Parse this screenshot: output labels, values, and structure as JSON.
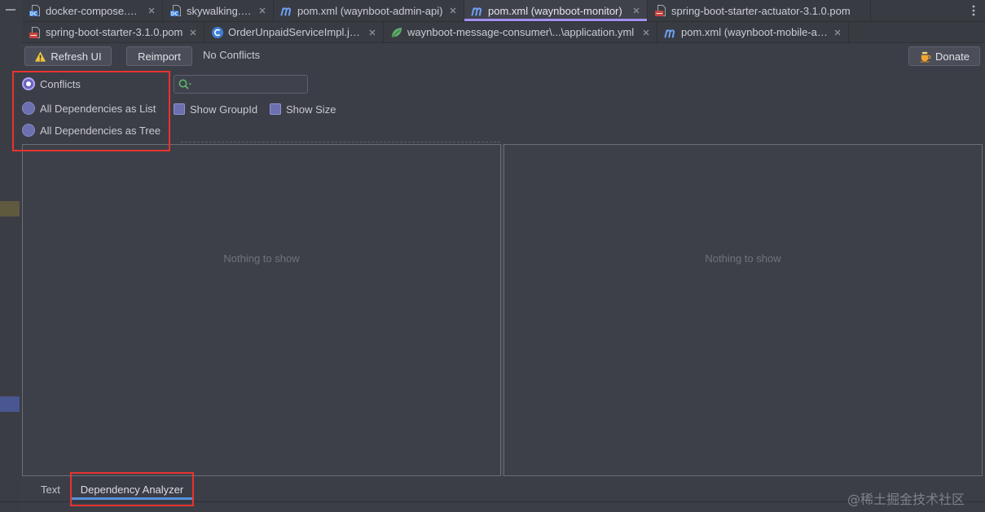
{
  "window": {
    "minimize_icon": "minimize-icon",
    "more_tabs_icon": "vertical-ellipsis-icon"
  },
  "editor_tabs": {
    "row1": [
      {
        "label": "docker-compose.yml",
        "icon": "docker-compose-file-icon",
        "active": false
      },
      {
        "label": "skywalking.yml",
        "icon": "docker-compose-file-icon",
        "active": false
      },
      {
        "label": "pom.xml (waynboot-admin-api)",
        "icon": "maven-icon",
        "active": false
      },
      {
        "label": "pom.xml (waynboot-monitor)",
        "icon": "maven-icon",
        "active": true
      },
      {
        "label": "spring-boot-starter-actuator-3.1.0.pom",
        "icon": "pom-file-icon",
        "active": false
      }
    ],
    "row2": [
      {
        "label": "spring-boot-starter-3.1.0.pom",
        "icon": "pom-file-icon",
        "active": false
      },
      {
        "label": "OrderUnpaidServiceImpl.java",
        "icon": "java-class-icon",
        "active": false
      },
      {
        "label": "waynboot-message-consumer\\...\\application.yml",
        "icon": "spring-config-icon",
        "active": false
      },
      {
        "label": "pom.xml (waynboot-mobile-api)",
        "icon": "maven-icon",
        "active": false
      }
    ]
  },
  "toolbar": {
    "refresh": {
      "label": "Refresh UI",
      "icon": "warning-icon"
    },
    "reimport": {
      "label": "Reimport"
    },
    "status": "No Conflicts",
    "donate": {
      "label": "Donate",
      "icon": "coffee-cup-icon"
    }
  },
  "view_mode": {
    "options": [
      {
        "label": "Conflicts",
        "selected": true
      },
      {
        "label": "All Dependencies as List",
        "selected": false
      },
      {
        "label": "All Dependencies as Tree",
        "selected": false
      }
    ]
  },
  "search": {
    "value": "",
    "icon": "search-icon"
  },
  "display_options": [
    {
      "label": "Show GroupId",
      "checked": false
    },
    {
      "label": "Show Size",
      "checked": false
    }
  ],
  "results": {
    "left_panel": {
      "empty_text": "Nothing to show"
    },
    "right_panel": {
      "empty_text": "Nothing to show"
    }
  },
  "bottom_tabs": [
    {
      "label": "Text",
      "active": false
    },
    {
      "label": "Dependency Analyzer",
      "active": true
    }
  ],
  "colors": {
    "background": "#3c3e47",
    "active_tab_underline": "#a08ff2",
    "selected_bottom_tab_underline": "#5491dd",
    "annotation_highlight": "#e8332f",
    "radio_fill": "#6c70b0",
    "search_icon": "#5cb86f"
  },
  "watermark": "@稀土掘金技术社区"
}
